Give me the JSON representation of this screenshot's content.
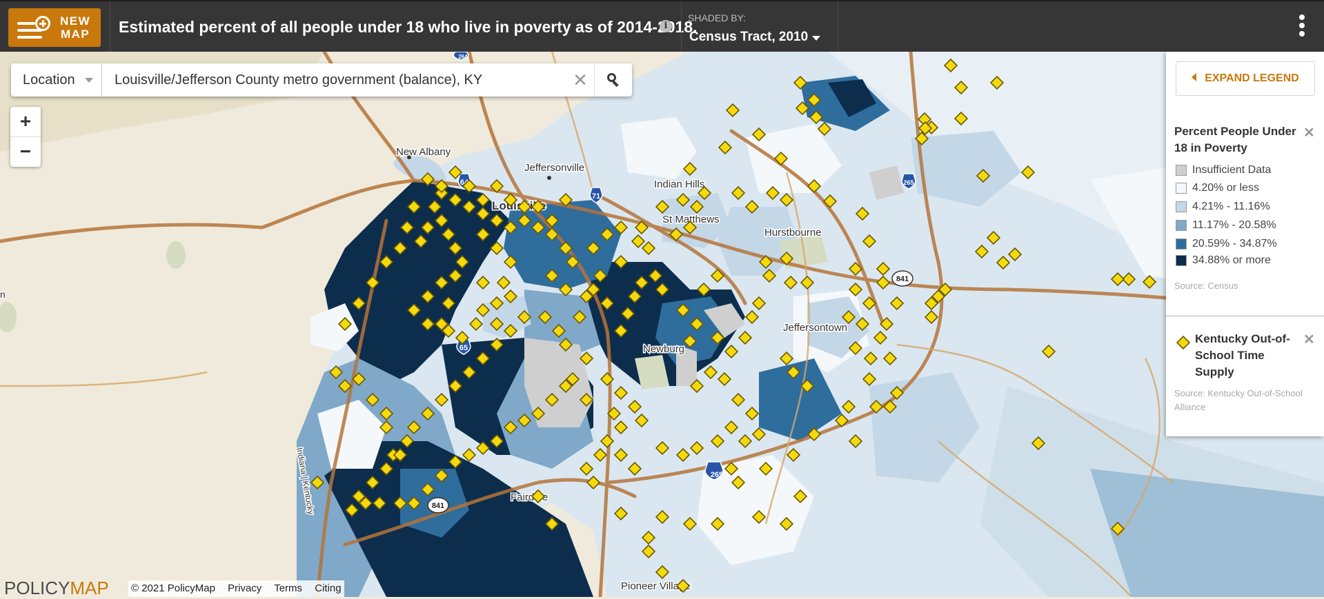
{
  "header": {
    "new_map_label_line1": "NEW",
    "new_map_label_line2": "MAP",
    "title": "Estimated percent of all people under 18 who live in poverty as of 2014-2018.",
    "info_icon": "i",
    "shaded_by_label": "SHADED BY:",
    "shaded_by_value": "Census Tract, 2010"
  },
  "search": {
    "location_dropdown": "Location",
    "value": "Louisville/Jefferson County metro government (balance), KY",
    "clear_glyph": "✕"
  },
  "zoom": {
    "in": "+",
    "out": "−"
  },
  "legend": {
    "expand_label": "EXPAND LEGEND",
    "close_glyph": "✕",
    "layer1": {
      "title": "Percent People Under 18 in Poverty",
      "items": [
        {
          "label": "Insufficient Data",
          "color": "#cfcfcf"
        },
        {
          "label": "4.20% or less",
          "color": "#f4f8fb"
        },
        {
          "label": "4.21% - 11.16%",
          "color": "#c4d7e7"
        },
        {
          "label": "11.17% - 20.58%",
          "color": "#7fa8c9"
        },
        {
          "label": "20.59% - 34.87%",
          "color": "#2f6d9d"
        },
        {
          "label": "34.88% or more",
          "color": "#0d2d4d"
        }
      ],
      "source": "Source: Census"
    },
    "layer2": {
      "title": "Kentucky Out-of-School Time Supply",
      "source": "Source: Kentucky Out-of-School Alliance",
      "marker_color": "#f5d90f"
    }
  },
  "map_labels": {
    "new_albany": "New Albany",
    "jeffersonville": "Jeffersonville",
    "louisville": "Louisville",
    "indian_hills": "Indian Hills",
    "st_matthews": "St Matthews",
    "hurstbourne": "Hurstbourne",
    "jeffersontown": "Jeffersontown",
    "newburg": "Newburg",
    "fairdale": "Fairdale",
    "pioneer_village": "Pioneer Village",
    "indiana_kentucky": "Indiana | Kentucky",
    "edge_n": "n"
  },
  "highway_shields": {
    "i64": "64",
    "i71": "71",
    "i265_top": "265",
    "i265_bottom": "265",
    "i65_left": "65",
    "i264": "264",
    "r841_a": "841",
    "r841_b": "841"
  },
  "footer": {
    "logo_policy": "POLICY",
    "logo_map": "MAP",
    "copyright": "© 2021 PolicyMap",
    "privacy": "Privacy",
    "terms": "Terms",
    "citing": "Citing"
  }
}
